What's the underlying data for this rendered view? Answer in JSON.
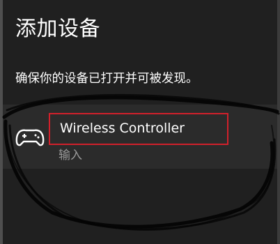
{
  "dialog": {
    "title": "添加设备",
    "subtitle": "确保你的设备已打开并可被发现。"
  },
  "devices": [
    {
      "name": "Wireless Controller",
      "type": "输入",
      "icon": "gamepad-icon"
    }
  ],
  "colors": {
    "background": "#202020",
    "row_background": "#2b2b2b",
    "highlight_box": "#d2202b",
    "secondary_text": "#9a9a9a"
  }
}
